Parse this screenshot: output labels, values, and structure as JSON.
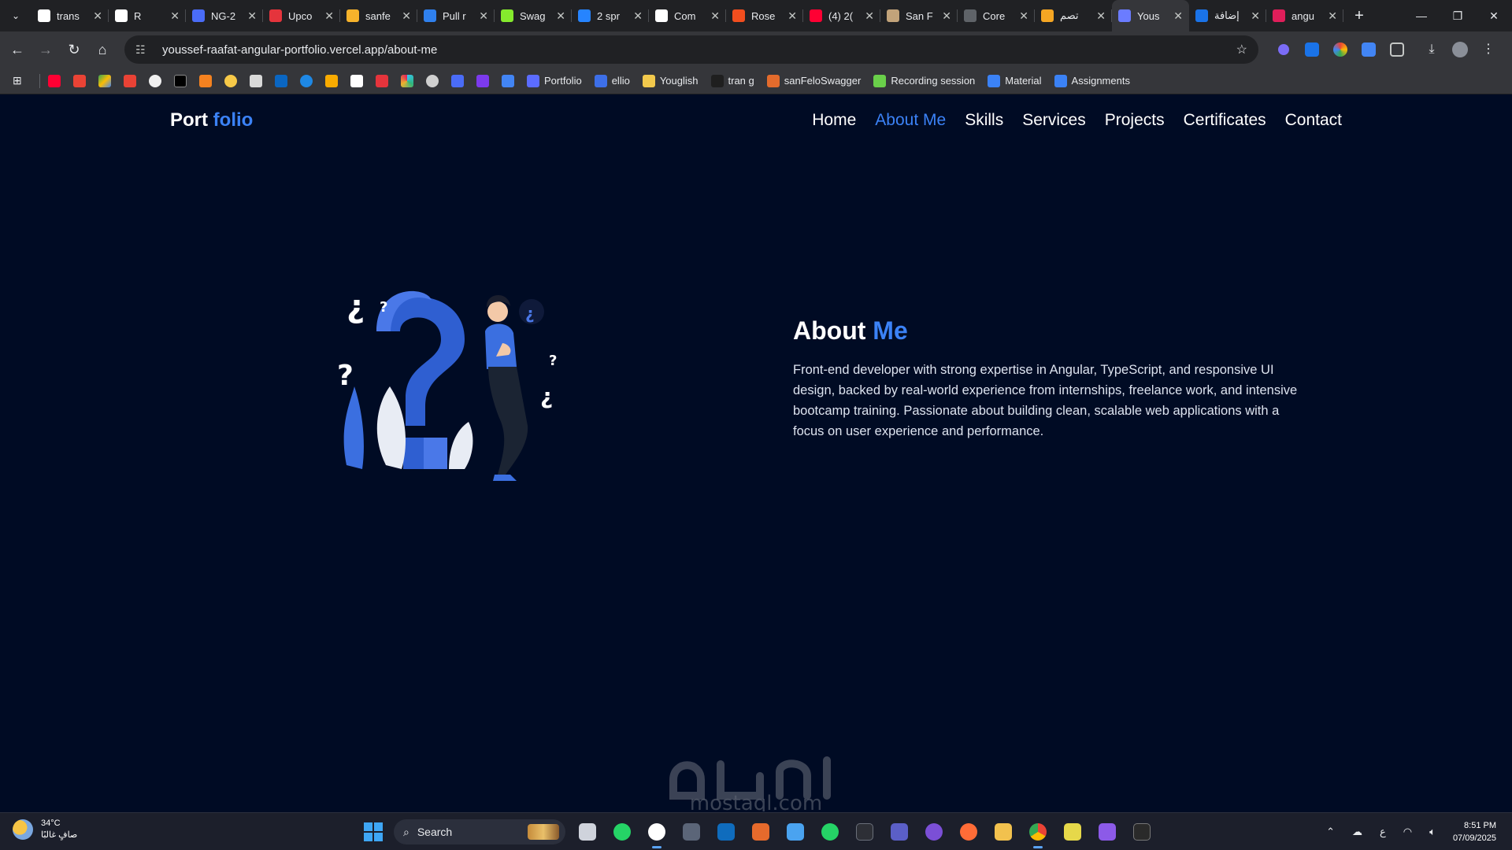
{
  "browser": {
    "tabs": [
      {
        "title": "trans",
        "icon": "google-icon",
        "color": "#ffffff"
      },
      {
        "title": "R",
        "icon": "openai-icon",
        "color": "#ffffff"
      },
      {
        "title": "NG-2",
        "icon": "angular-icon",
        "color": "#4a6cf7"
      },
      {
        "title": "Upco",
        "icon": "app-red-icon",
        "color": "#e5343c"
      },
      {
        "title": "sanfe",
        "icon": "generic-icon",
        "color": "#f7b32b"
      },
      {
        "title": "Pull r",
        "icon": "azure-devops-icon",
        "color": "#2f80ed"
      },
      {
        "title": "Swag",
        "icon": "swagger-icon",
        "color": "#85ea2d"
      },
      {
        "title": "2 spr",
        "icon": "jira-icon",
        "color": "#2684ff"
      },
      {
        "title": "Com",
        "icon": "github-icon",
        "color": "#ffffff"
      },
      {
        "title": "Rose",
        "icon": "figma-icon",
        "color": "#f24e1e"
      },
      {
        "title": "(4) 2(",
        "icon": "youtube-icon",
        "color": "#ff0033"
      },
      {
        "title": "San F",
        "icon": "generic-icon",
        "color": "#c2a37a"
      },
      {
        "title": "Core",
        "icon": "loading-icon",
        "color": "#5f6368"
      },
      {
        "title": "تصم",
        "icon": "generic-icon",
        "color": "#f5a623"
      },
      {
        "title": "Yous",
        "icon": "portfolio-icon",
        "color": "#6b7cff"
      },
      {
        "title": "إضافة",
        "icon": "generic-icon",
        "color": "#1a73e8"
      },
      {
        "title": "angu",
        "icon": "slack-icon",
        "color": "#e01e5a"
      }
    ],
    "active_tab_index": 14,
    "url": "youssef-raafat-angular-portfolio.vercel.app/about-me",
    "bookmarks": [
      {
        "label": "Portfolio"
      },
      {
        "label": "ellio"
      },
      {
        "label": "Youglish"
      },
      {
        "label": "tran g"
      },
      {
        "label": "sanFeloSwagger"
      },
      {
        "label": "Recording session"
      },
      {
        "label": "Material"
      },
      {
        "label": "Assignments"
      }
    ]
  },
  "site": {
    "logo_main": "Port ",
    "logo_accent": "folio",
    "nav": [
      "Home",
      "About Me",
      "Skills",
      "Services",
      "Projects",
      "Certificates",
      "Contact"
    ],
    "active_nav_index": 1,
    "about": {
      "title_main": "About ",
      "title_accent": "Me",
      "body": "Front-end developer with strong expertise in Angular, TypeScript, and responsive UI design, backed by real-world experience from internships, freelance work, and intensive bootcamp training. Passionate about building clean, scalable web applications with a focus on user experience and performance."
    },
    "accent_color": "#3b82f6",
    "background_color": "#000b24"
  },
  "watermark": "mostaql.com",
  "taskbar": {
    "weather_temp": "34°C",
    "weather_desc": "صافٍ غالبًا",
    "search_label": "Search",
    "lang": "ع",
    "time": "8:51 PM",
    "date": "07/09/2025"
  }
}
